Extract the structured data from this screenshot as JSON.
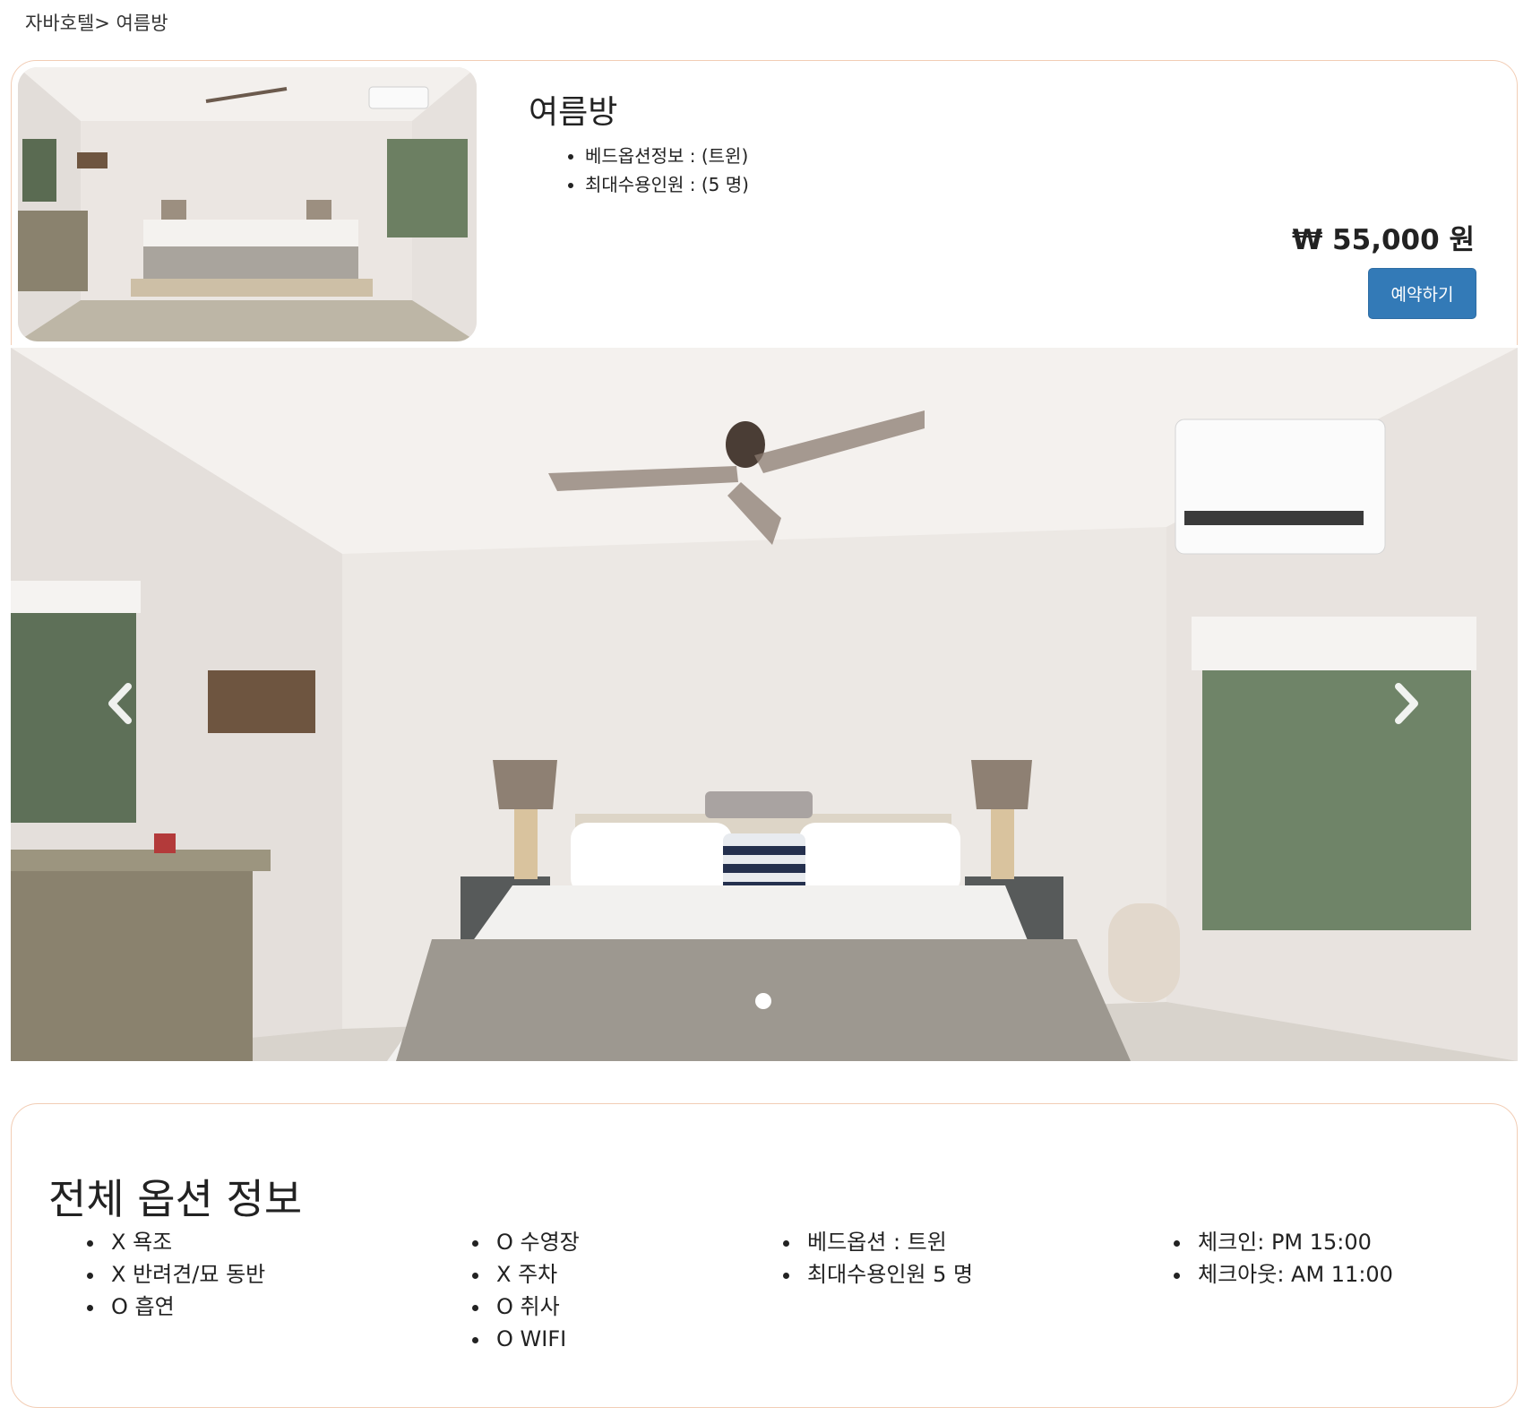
{
  "breadcrumb": "자바호텔> 여름방",
  "room": {
    "title": "여름방",
    "info": [
      "베드옵션정보 : (트윈)",
      "최대수용인원 : (5 명)"
    ],
    "price": "₩ 55,000 원",
    "reserve_label": "예약하기"
  },
  "carousel": {
    "prev_icon": "chevron-left-icon",
    "next_icon": "chevron-right-icon",
    "slide_count": 1,
    "active_slide": 1
  },
  "options": {
    "title": "전체 옵션 정보",
    "col1": [
      "X 욕조",
      "X 반려견/묘 동반",
      "O 흡연"
    ],
    "col2": [
      "O 수영장",
      "X 주차",
      "O 취사",
      "O WIFI"
    ],
    "col3": [
      "베드옵션 : 트윈",
      "최대수용인원 5 명"
    ],
    "col4": [
      "체크인: PM 15:00",
      "체크아웃: AM 11:00"
    ]
  },
  "colors": {
    "accent_button": "#337ab7",
    "card_border": "#f2cdb5"
  }
}
